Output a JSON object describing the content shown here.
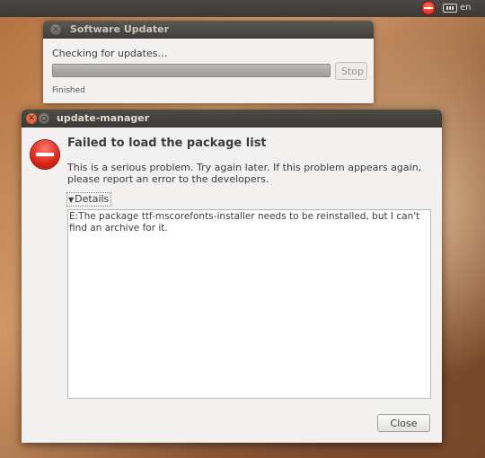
{
  "top_panel": {
    "language": "en"
  },
  "software_updater": {
    "title": "Software Updater",
    "checking_text": "Checking for updates…",
    "stop_label": "Stop",
    "status_text": "Finished",
    "progress": 1.0
  },
  "dialog": {
    "title": "update-manager",
    "close_glyph": "✕",
    "heading": "Failed to load the package list",
    "message": "This is a serious problem. Try again later. If this problem appears again, please report an error to the developers.",
    "details_label": "Details",
    "details_text": "E:The package ttf-mscorefonts-installer needs to be reinstalled, but I can't find an archive for it.",
    "close_button_label": "Close"
  },
  "colors": {
    "error_red": "#d9271a",
    "titlebar_dark": "#3a3935",
    "window_bg": "#f2f1f0",
    "close_orange": "#d0471a"
  },
  "icons": {
    "panel_indicator": "stop-icon",
    "keyboard": "keyboard-icon",
    "dialog_icon": "error-icon"
  }
}
